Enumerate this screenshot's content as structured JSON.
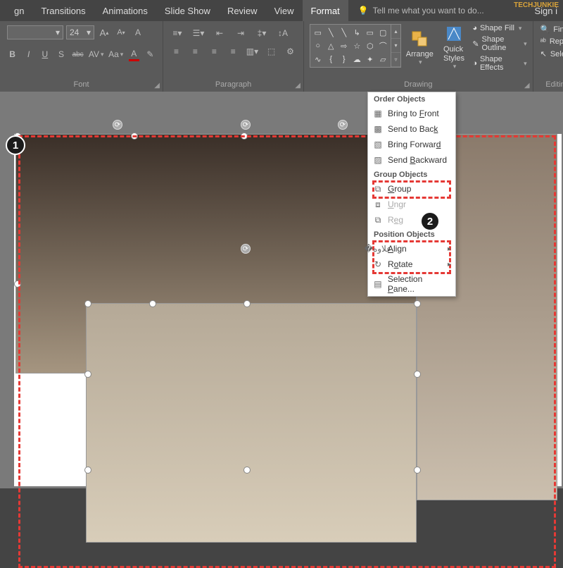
{
  "watermark": "TECHJUNKIE",
  "menubar": {
    "partial": "gn",
    "items": [
      "Transitions",
      "Animations",
      "Slide Show",
      "Review",
      "View",
      "Format"
    ],
    "active": "Format",
    "tellme_placeholder": "Tell me what you want to do...",
    "signin": "Sign i"
  },
  "ribbon": {
    "font": {
      "label": "Font",
      "size_value": "24",
      "buttons": {
        "bold": "B",
        "italic": "I",
        "underline": "U",
        "strike": "S",
        "shadow": "abc",
        "spacing": "AV",
        "casechange": "Aa",
        "fontcolor": "A",
        "highlight": "✎",
        "incA": "A",
        "decA": "A",
        "clear": "A"
      }
    },
    "paragraph": {
      "label": "Paragraph"
    },
    "drawing": {
      "label": "Drawing",
      "arrange": "Arrange",
      "quick_styles": "Quick\nStyles",
      "shape_fill": "Shape Fill",
      "shape_outline": "Shape Outline",
      "shape_effects": "Shape Effects"
    },
    "editing": {
      "label": "Editing",
      "find": "Find",
      "replace": "Replac",
      "select": "Select"
    }
  },
  "dropdown": {
    "order_header": "Order Objects",
    "bring_front": "Bring to Front",
    "send_back": "Send to Back",
    "bring_forward": "Bring Forward",
    "send_backward": "Send Backward",
    "group_header": "Group Objects",
    "group": "Group",
    "ungroup": "Ungr",
    "regroup": "Reg",
    "position_header": "Position Objects",
    "align": "Align",
    "rotate": "Rotate",
    "selection_pane": "Selection Pane..."
  },
  "badges": {
    "one": "1",
    "two": "2"
  }
}
